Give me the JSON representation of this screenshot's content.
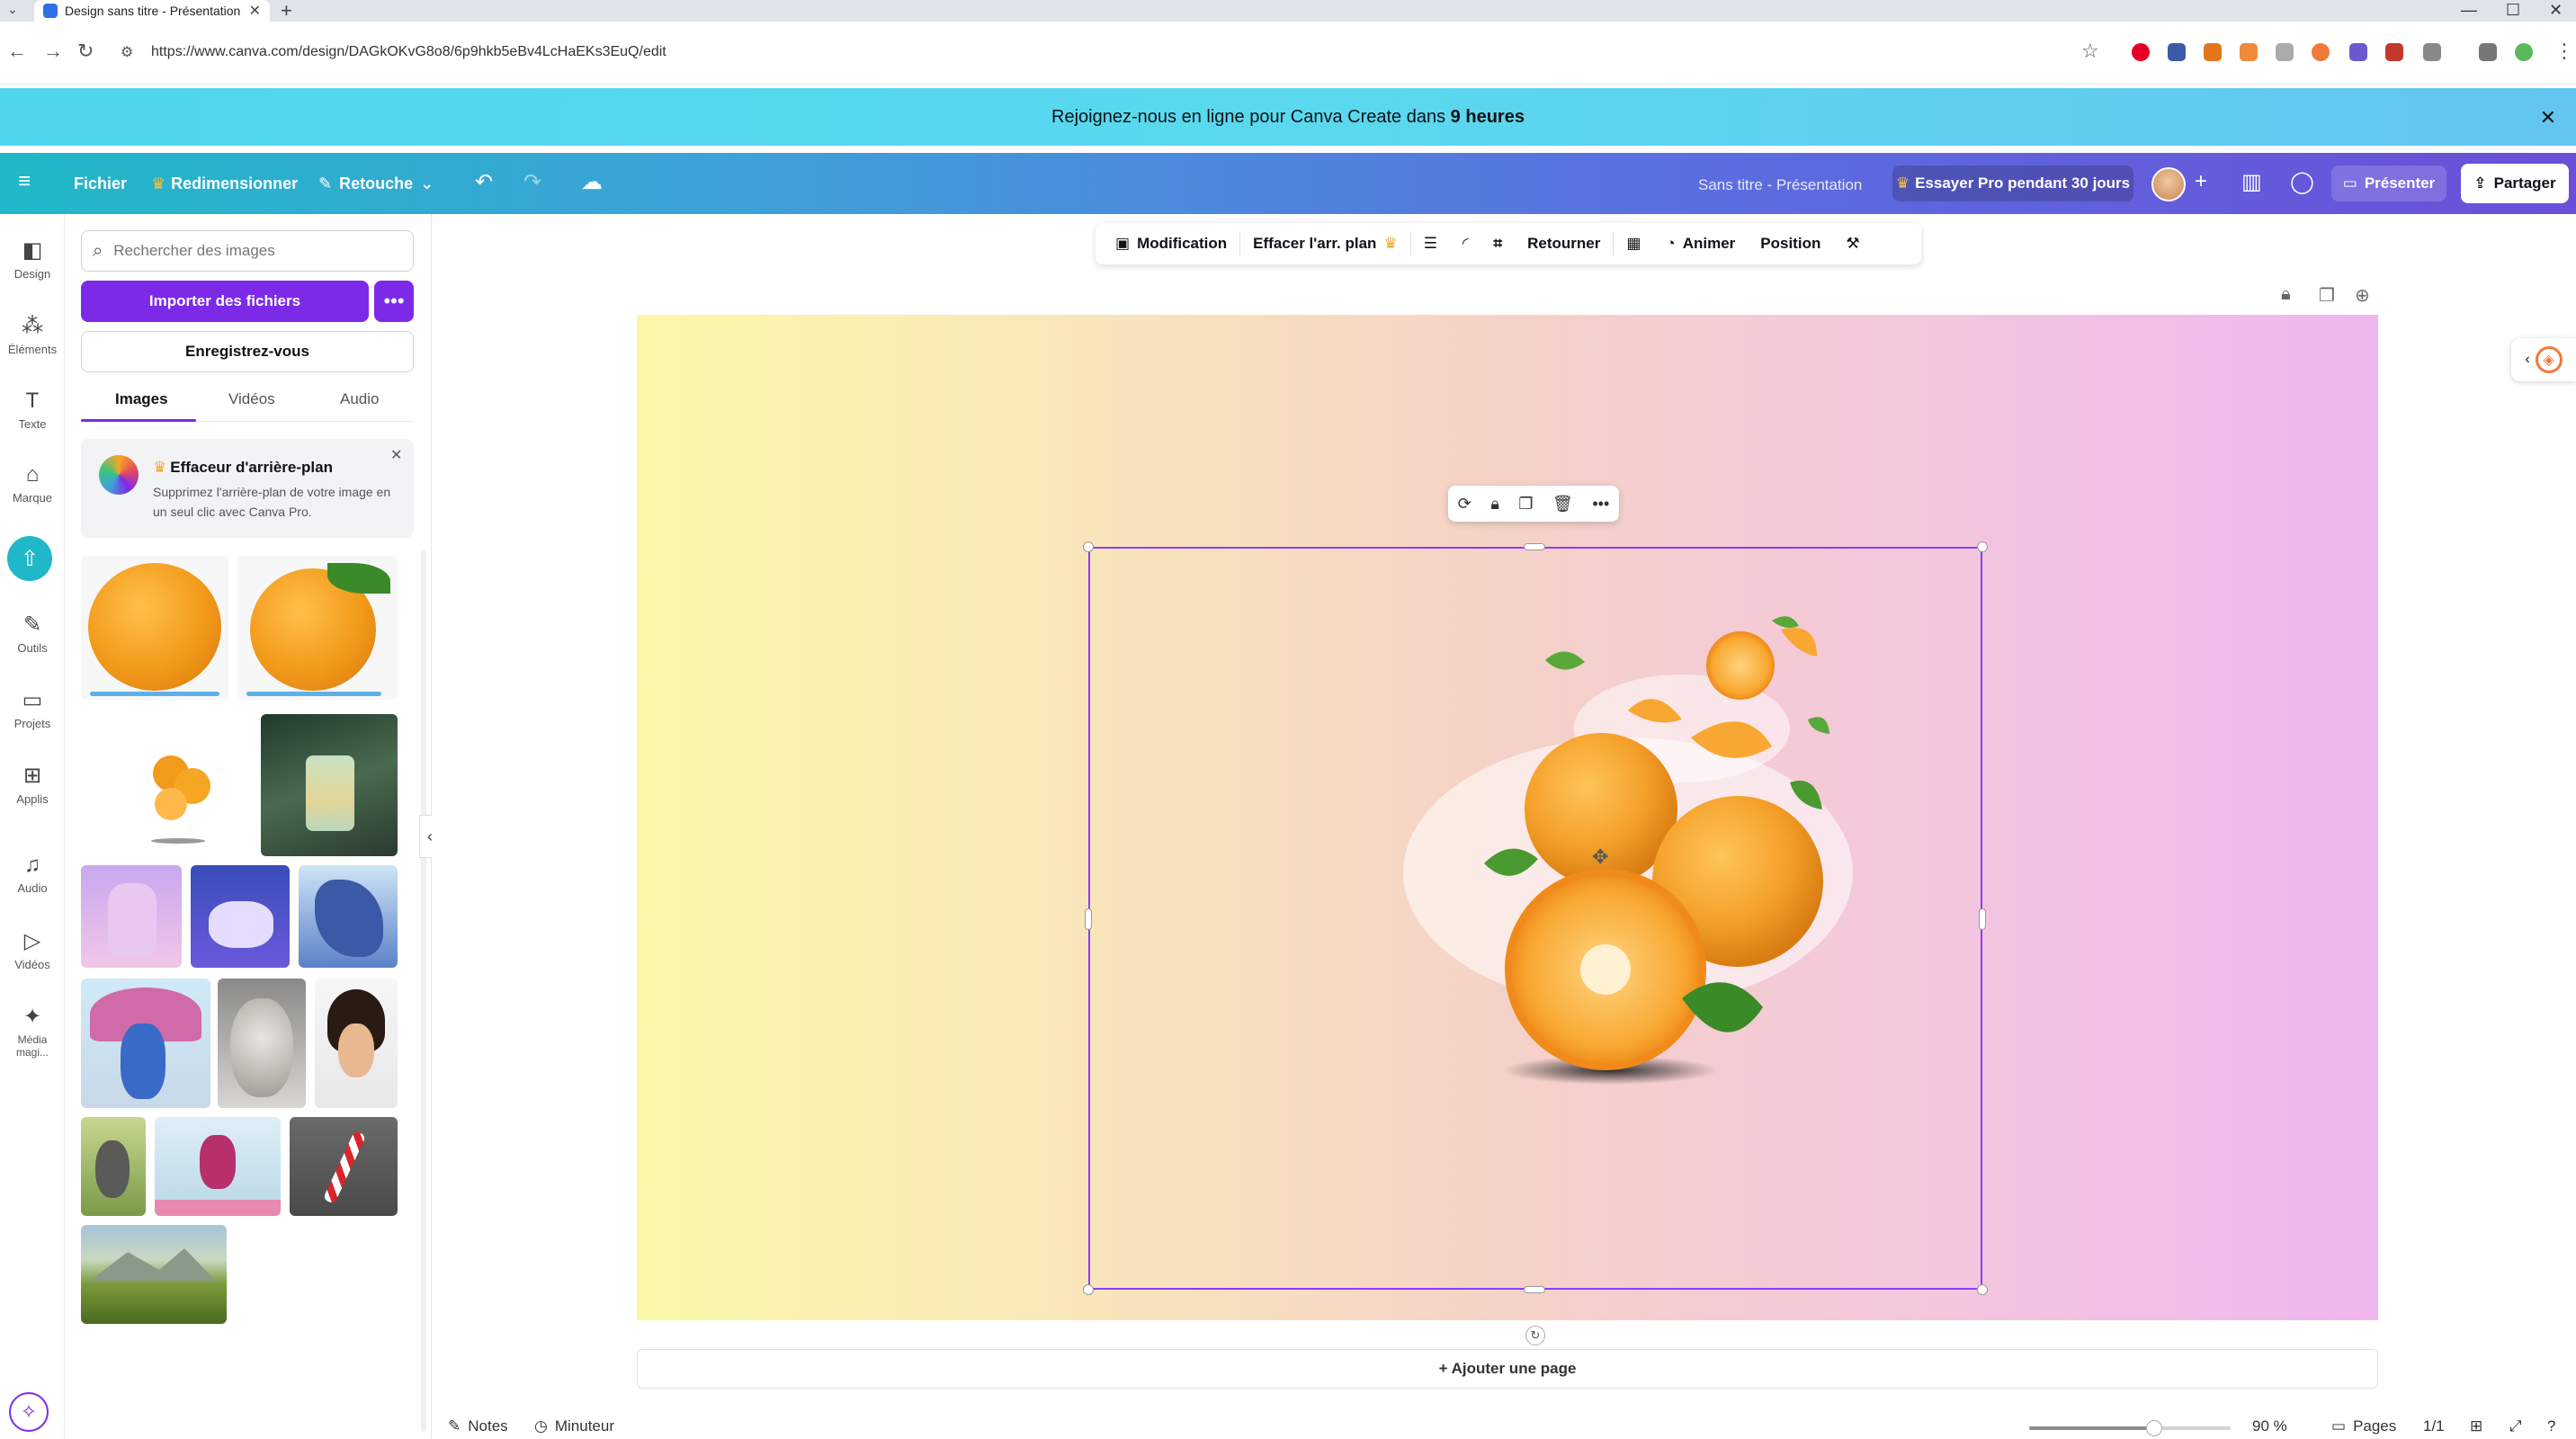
{
  "browser": {
    "tab_title": "Design sans titre - Présentation",
    "tab_close": "✕",
    "new_tab": "+",
    "url": "https://www.canva.com/design/DAGkOKvG8o8/6p9hkb5eBv4LcHaEKs3EuQ/edit",
    "window_controls": [
      "—",
      "☐",
      "✕"
    ]
  },
  "banner": {
    "text_before": "Rejoignez-nous en ligne pour Canva Create dans",
    "text_bold": "9 heures"
  },
  "header": {
    "menu_icon": "hamburger-icon",
    "file": "Fichier",
    "resize": "Redimensionner",
    "retouch": "Retouche",
    "title": "Sans titre - Présentation",
    "try_pro": "Essayer Pro pendant 30 jours",
    "present": "Présenter",
    "share": "Partager"
  },
  "rail": {
    "items": [
      {
        "label": "Design",
        "icon": "design-icon"
      },
      {
        "label": "Éléments",
        "icon": "elements-icon"
      },
      {
        "label": "Texte",
        "icon": "text-icon"
      },
      {
        "label": "Marque",
        "icon": "brand-icon"
      },
      {
        "label": "Outils",
        "icon": "tools-icon"
      },
      {
        "label": "Projets",
        "icon": "projects-icon"
      },
      {
        "label": "Applis",
        "icon": "apps-icon"
      },
      {
        "label": "Audio",
        "icon": "audio-icon"
      },
      {
        "label": "Vidéos",
        "icon": "videos-icon"
      },
      {
        "label": "Média magi...",
        "icon": "magic-media-icon"
      }
    ]
  },
  "panel": {
    "search_placeholder": "Rechercher des images",
    "import": "Importer des fichiers",
    "import_more": "•••",
    "register": "Enregistrez-vous",
    "tabs": [
      "Images",
      "Vidéos",
      "Audio"
    ],
    "active_tab": "Images",
    "promo_title": "Effaceur d'arrière-plan",
    "promo_text": "Supprimez l'arrière-plan de votre image en un seul clic avec Canva Pro."
  },
  "toolbar": {
    "edit": "Modification",
    "remove_bg": "Effacer l'arr. plan",
    "flip": "Retourner",
    "animate": "Animer",
    "position": "Position"
  },
  "canvas": {
    "add_page": "+ Ajouter une page"
  },
  "footer": {
    "notes": "Notes",
    "timer": "Minuteur",
    "zoom": "90 %",
    "zoom_level": 0.62,
    "pages": "Pages",
    "page_count": "1/1"
  },
  "colors": {
    "accent": "#7d2ae8",
    "selection": "#8b3dff",
    "banner": "#5ad9ee"
  }
}
